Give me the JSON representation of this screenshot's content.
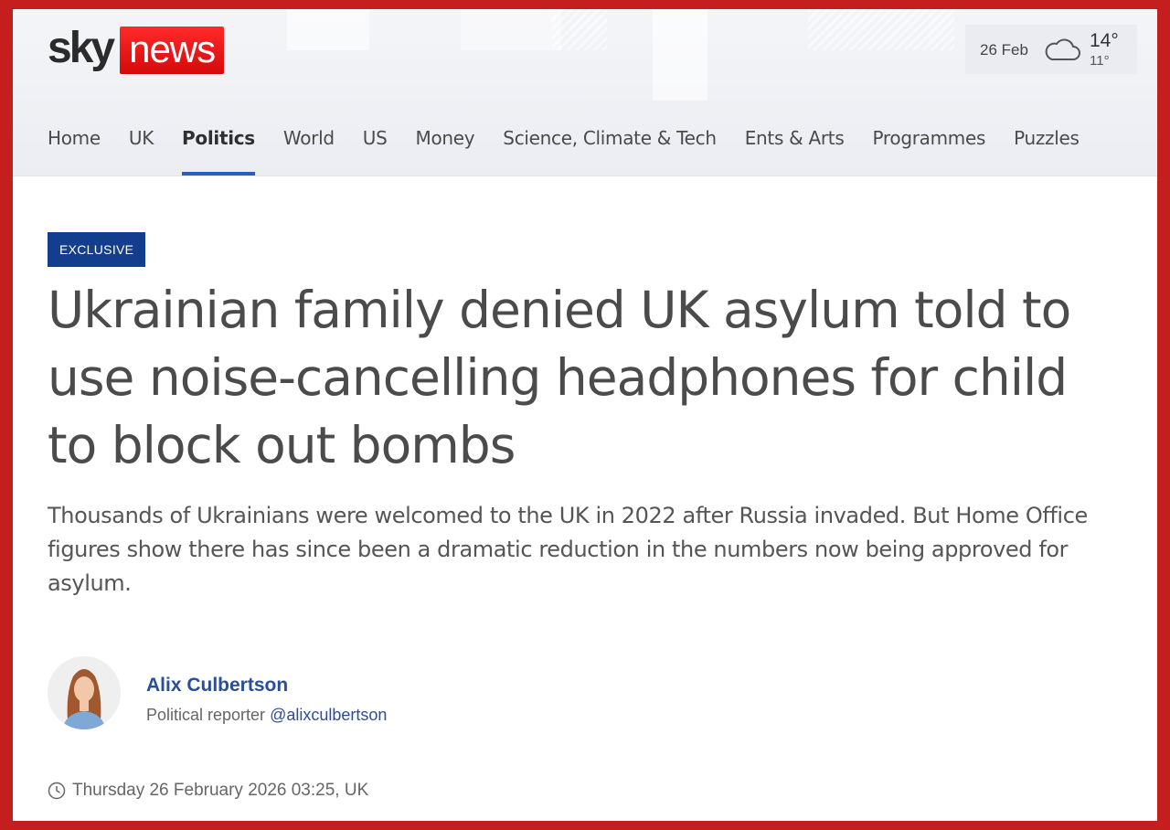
{
  "brand": {
    "sky": "sky",
    "news": "news",
    "accent": "#e10000"
  },
  "weather": {
    "date": "26 Feb",
    "icon": "cloud-icon",
    "high": "14°",
    "low": "11°"
  },
  "nav": {
    "items": [
      {
        "label": "Home"
      },
      {
        "label": "UK"
      },
      {
        "label": "Politics",
        "active": true
      },
      {
        "label": "World"
      },
      {
        "label": "US"
      },
      {
        "label": "Money"
      },
      {
        "label": "Science, Climate & Tech"
      },
      {
        "label": "Ents & Arts"
      },
      {
        "label": "Programmes"
      },
      {
        "label": "Puzzles"
      }
    ]
  },
  "article": {
    "badge": "EXCLUSIVE",
    "headline": "Ukrainian family denied UK asylum told to use noise-cancelling headphones for child to block out bombs",
    "standfirst": "Thousands of Ukrainians were welcomed to the UK in 2022 after Russia invaded. But Home Office figures show there has since been a dramatic reduction in the numbers now being approved for asylum.",
    "author": {
      "name": "Alix Culbertson",
      "role": "Political reporter",
      "handle": "@alixculbertson"
    },
    "timestamp": "Thursday 26 February 2026 03:25, UK"
  },
  "colors": {
    "badge": "#133e8e",
    "link": "#2a4f9a",
    "frame": "#c41e1e",
    "nav_underline": "#2a5eb8"
  }
}
